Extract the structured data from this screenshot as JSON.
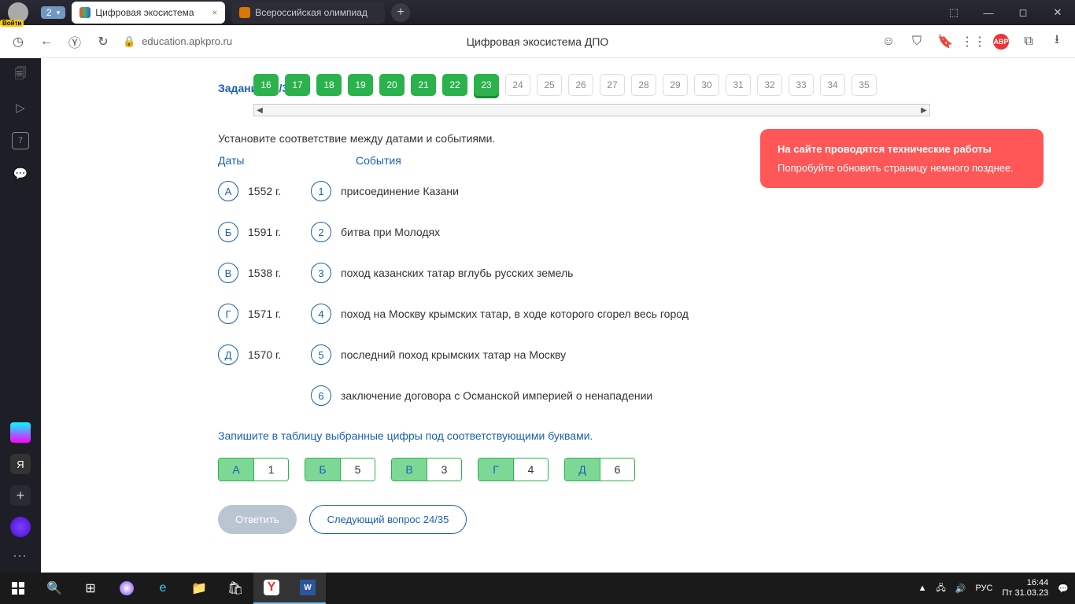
{
  "titlebar": {
    "login": "Войти",
    "counter": "2",
    "tab1": "Цифровая экосистема",
    "tab2": "Всероссийская олимпиад"
  },
  "addr": {
    "url": "education.apkpro.ru",
    "title": "Цифровая экосистема ДПО"
  },
  "task": {
    "header": "Задание 23/35"
  },
  "qnav": [
    "16",
    "17",
    "18",
    "19",
    "20",
    "21",
    "22",
    "23",
    "24",
    "25",
    "26",
    "27",
    "28",
    "29",
    "30",
    "31",
    "32",
    "33",
    "34",
    "35"
  ],
  "instruction": "Установите соответствие между датами и событиями.",
  "col_dates": "Даты",
  "col_events": "События",
  "dates": [
    {
      "l": "А",
      "v": "1552 г."
    },
    {
      "l": "Б",
      "v": "1591 г."
    },
    {
      "l": "В",
      "v": "1538 г."
    },
    {
      "l": "Г",
      "v": "1571 г."
    },
    {
      "l": "Д",
      "v": "1570 г."
    }
  ],
  "events": [
    {
      "n": "1",
      "t": "присоединение Казани"
    },
    {
      "n": "2",
      "t": "битва при Молодях"
    },
    {
      "n": "3",
      "t": "поход казанских татар вглубь русских земель"
    },
    {
      "n": "4",
      "t": "поход на Москву крымских татар, в ходе которого сгорел весь город"
    },
    {
      "n": "5",
      "t": "последний поход крымских татар на Москву"
    },
    {
      "n": "6",
      "t": "заключение договора с Османской империей о ненападении"
    }
  ],
  "instruction2": "Запишите в таблицу выбранные цифры под соответствующими буквами.",
  "answers": [
    {
      "l": "А",
      "v": "1"
    },
    {
      "l": "Б",
      "v": "5"
    },
    {
      "l": "В",
      "v": "3"
    },
    {
      "l": "Г",
      "v": "4"
    },
    {
      "l": "Д",
      "v": "6"
    }
  ],
  "btn_answer": "Ответить",
  "btn_next": "Следующий вопрос 24/35",
  "toast": {
    "title": "На сайте проводятся технические работы",
    "body": "Попробуйте обновить страницу немного позднее."
  },
  "taskbar": {
    "lang": "РУС",
    "time": "16:44",
    "date": "Пт 31.03.23"
  },
  "abp": "ABP",
  "sidebar": {
    "day": "7",
    "ya": "Я"
  }
}
